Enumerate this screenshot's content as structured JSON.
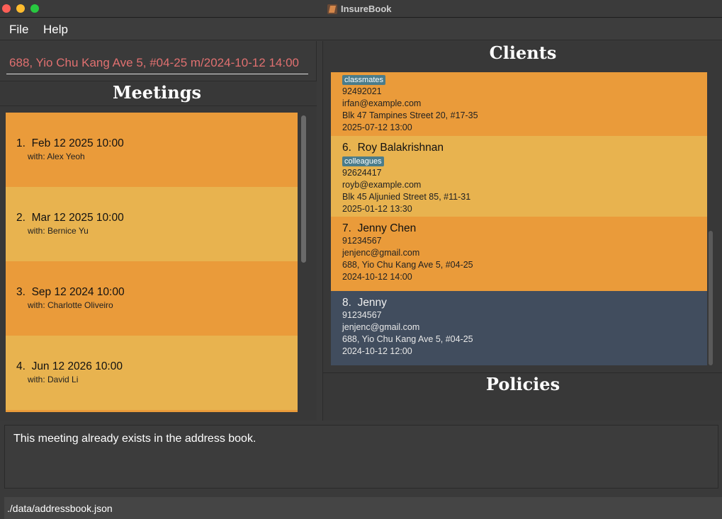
{
  "window": {
    "title": "InsureBook"
  },
  "menu": {
    "file": "File",
    "help": "Help"
  },
  "command": {
    "value": "688, Yio Chu Kang Ave 5, #04-25 m/2024-10-12 14:00"
  },
  "meetings": {
    "title": "Meetings",
    "items": [
      {
        "index": "1.",
        "datetime": "Feb 12 2025 10:00",
        "with": "with: Alex Yeoh"
      },
      {
        "index": "2.",
        "datetime": "Mar 12 2025 10:00",
        "with": "with: Bernice Yu"
      },
      {
        "index": "3.",
        "datetime": "Sep 12 2024 10:00",
        "with": "with: Charlotte Oliveiro"
      },
      {
        "index": "4.",
        "datetime": "Jun 12 2026 10:00",
        "with": "with: David Li"
      }
    ]
  },
  "clients": {
    "title": "Clients",
    "items": [
      {
        "tag": "classmates",
        "phone": "92492021",
        "email": "irfan@example.com",
        "address": "Blk 47 Tampines Street 20, #17-35",
        "meeting": "2025-07-12 13:00"
      },
      {
        "index": "6.",
        "name": "Roy Balakrishnan",
        "tag": "colleagues",
        "phone": "92624417",
        "email": "royb@example.com",
        "address": "Blk 45 Aljunied Street 85, #11-31",
        "meeting": "2025-01-12 13:30"
      },
      {
        "index": "7.",
        "name": "Jenny Chen",
        "phone": "91234567",
        "email": "jenjenc@gmail.com",
        "address": "688, Yio Chu Kang Ave 5, #04-25",
        "meeting": "2024-10-12 14:00"
      },
      {
        "index": "8.",
        "name": "Jenny",
        "phone": "91234567",
        "email": "jenjenc@gmail.com",
        "address": "688, Yio Chu Kang Ave 5, #04-25",
        "meeting": "2024-10-12 12:00"
      }
    ]
  },
  "policies": {
    "title": "Policies"
  },
  "result": {
    "message": "This meeting already exists in the address book."
  },
  "status": {
    "path": "./data/addressbook.json"
  },
  "colors": {
    "orange": "#ea9b3a",
    "yellow": "#e8b34f",
    "selected": "#414d5e",
    "tag": "#4a7c8b",
    "command_text": "#e07070"
  }
}
